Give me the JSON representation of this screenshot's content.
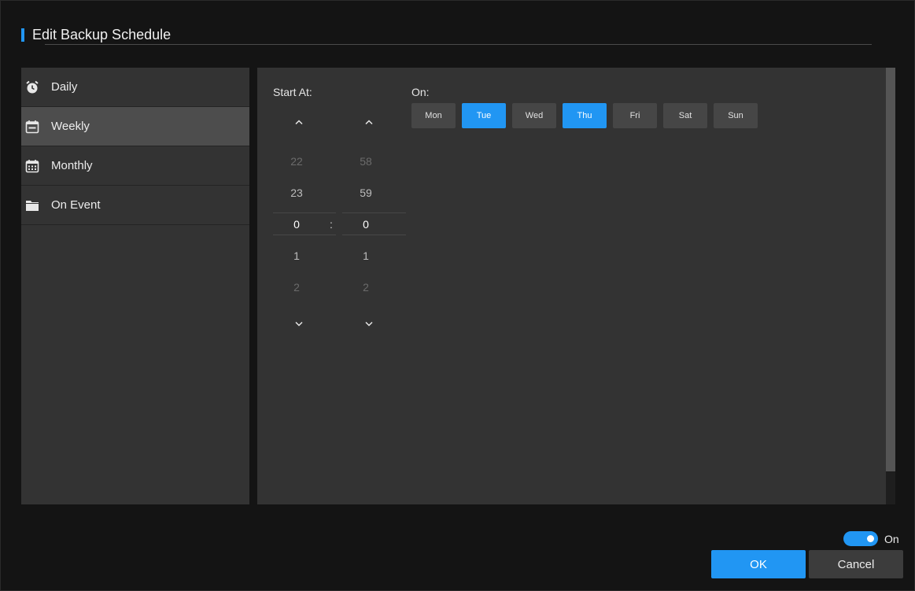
{
  "dialog": {
    "title": "Edit Backup Schedule"
  },
  "sidebar": {
    "items": [
      {
        "label": "Daily",
        "icon": "alarm-clock-icon"
      },
      {
        "label": "Weekly",
        "icon": "calendar-week-icon",
        "selected": true
      },
      {
        "label": "Monthly",
        "icon": "calendar-month-icon"
      },
      {
        "label": "On Event",
        "icon": "folder-icon"
      }
    ]
  },
  "schedule": {
    "start_label": "Start At:",
    "on_label": "On:",
    "colon": ":",
    "hours": {
      "above2": "22",
      "above1": "23",
      "selected": "0",
      "below1": "1",
      "below2": "2"
    },
    "minutes": {
      "above2": "58",
      "above1": "59",
      "selected": "0",
      "below1": "1",
      "below2": "2"
    },
    "days": [
      {
        "label": "Mon",
        "selected": false
      },
      {
        "label": "Tue",
        "selected": true
      },
      {
        "label": "Wed",
        "selected": false
      },
      {
        "label": "Thu",
        "selected": true
      },
      {
        "label": "Fri",
        "selected": false
      },
      {
        "label": "Sat",
        "selected": false
      },
      {
        "label": "Sun",
        "selected": false
      }
    ]
  },
  "footer": {
    "toggle_label": "On",
    "toggle_on": true,
    "ok_label": "OK",
    "cancel_label": "Cancel"
  },
  "colors": {
    "accent": "#2196f3",
    "panel": "#333333",
    "background": "#141414"
  }
}
